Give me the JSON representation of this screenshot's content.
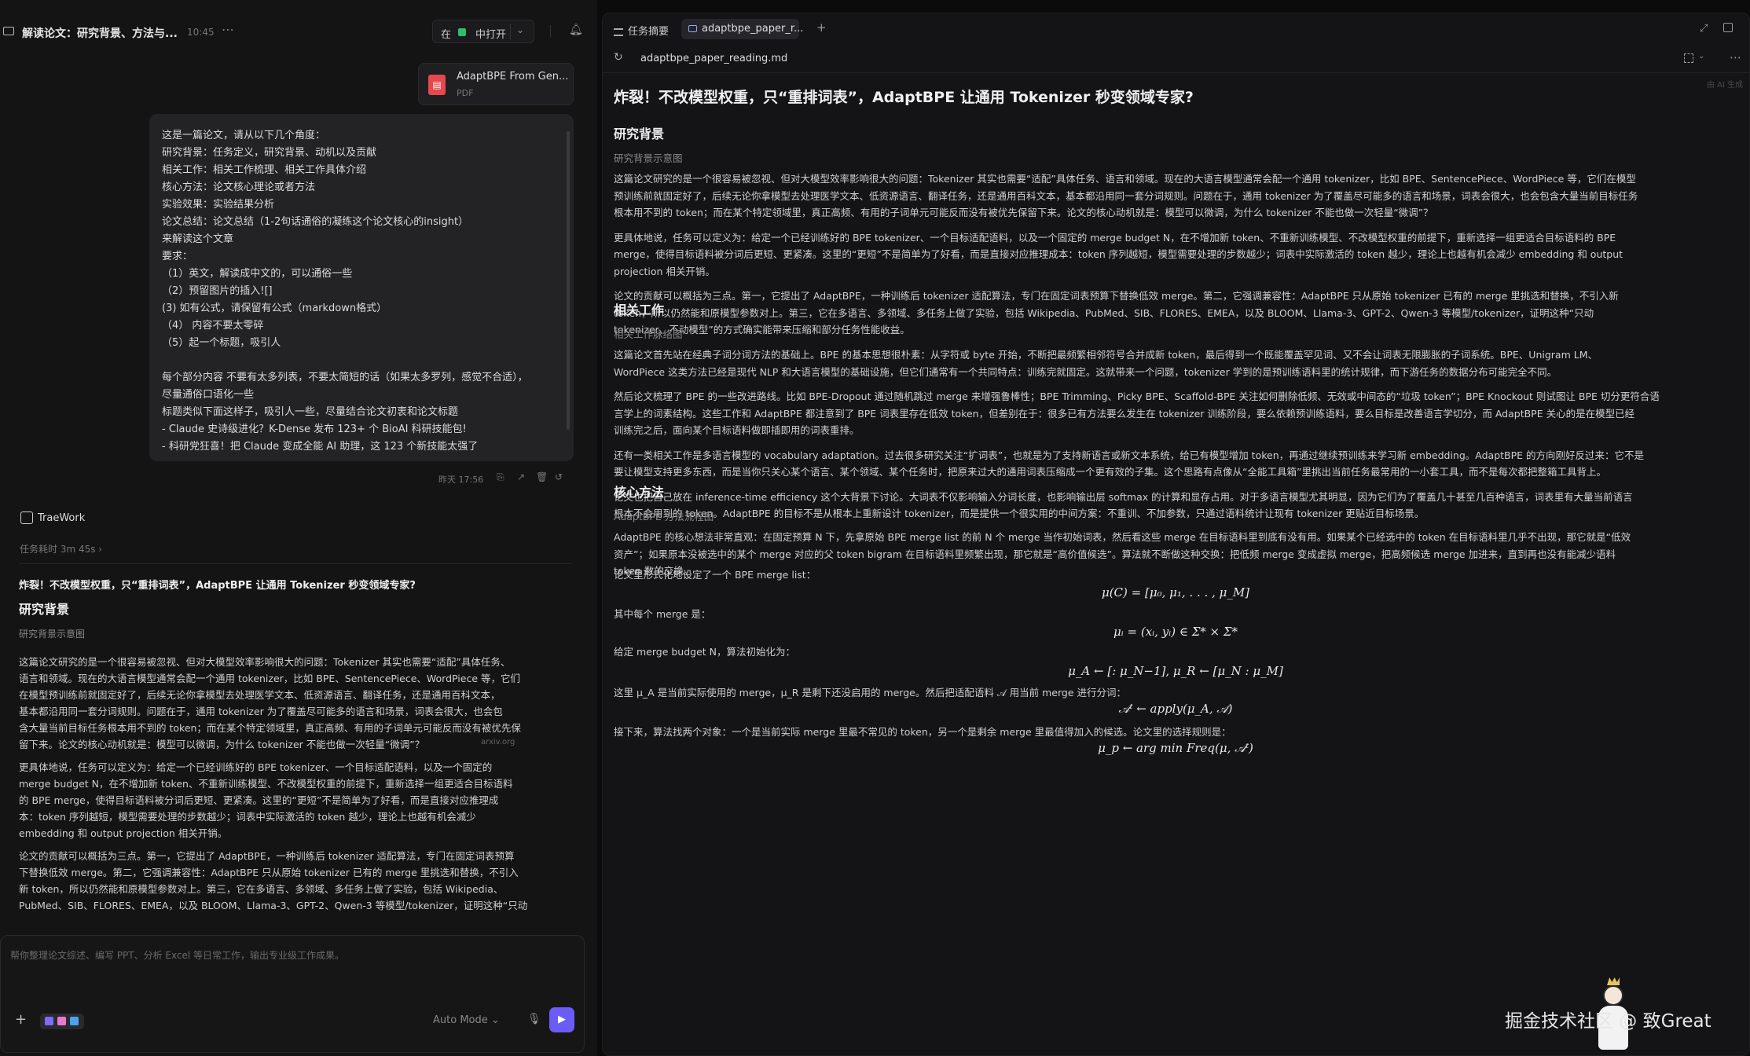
{
  "left": {
    "title": "解读论文：研究背景、方法与...",
    "time": "10:45",
    "open_in": {
      "prefix": "在",
      "app": "中打开"
    },
    "pdf": {
      "name": "AdaptBPE From Gen...",
      "type": "PDF"
    },
    "user_lines": [
      "这是一篇论文，请从以下几个角度：",
      "研究背景：任务定义，研究背景、动机以及贡献",
      "相关工作：相关工作梳理、相关工作具体介绍",
      "核心方法：论文核心理论或者方法",
      "实验效果：实验结果分析",
      "论文总结：论文总结（1-2句话通俗的凝练这个论文核心的insight）",
      "来解读这个文章",
      "要求：",
      "（1）英文，解读成中文的，可以通俗一些",
      "（2）预留图片的插入![]",
      "(3) 如有公式，请保留有公式（markdown格式）",
      "（4） 内容不要太零碎",
      "（5）起一个标题，吸引人",
      "",
      "每个部分内容 不要有太多列表，不要太简短的话（如果太多罗列，感觉不合适），",
      "尽量通俗口语化一些",
      "标题类似下面这样子，吸引人一些，尽量结合论文初衷和论文标题",
      "- Claude 史诗级进化？K-Dense 发布 123+ 个 BioAI 科研技能包!",
      "- 科研党狂喜！把 Claude 变成全能 AI 助理，这 123 个新技能太强了"
    ],
    "msg_time": "昨天 17:56",
    "agent_name": "TraeWork",
    "task_time": "任务耗时 3m 45s ›",
    "answer": {
      "title": "炸裂！不改模型权重，只“重排词表”，AdaptBPE 让通用 Tokenizer 秒变领域专家?",
      "h2": "研究背景",
      "caption": "研究背景示意图",
      "lines": [
        "这篇论文研究的是一个很容易被忽视、但对大模型效率影响很大的问题：Tokenizer 其实也需要“适配”具体任务、",
        "语言和领域。现在的大语言模型通常会配一个通用 tokenizer，比如 BPE、SentencePiece、WordPiece 等，它们",
        "在模型预训练前就固定好了，后续无论你拿模型去处理医学文本、低资源语言、翻译任务，还是通用百科文本，",
        "基本都沿用同一套分词规则。问题在于，通用 tokenizer 为了覆盖尽可能多的语言和场景，词表会很大，也会包",
        "含大量当前目标任务根本用不到的 token；而在某个特定领域里，真正高频、有用的子词单元可能反而没有被优先保",
        "留下来。论文的核心动机就是：模型可以微调，为什么 tokenizer 不能也做一次轻量“微调”？",
        "",
        "更具体地说，任务可以定义为：给定一个已经训练好的 BPE tokenizer、一个目标适配语料，以及一个固定的",
        "merge budget N，在不增加新 token、不重新训练模型、不改模型权重的前提下，重新选择一组更适合目标语料",
        "的 BPE merge，使得目标语料被分词后更短、更紧凑。这里的“更短”不是简单为了好看，而是直接对应推理成",
        "本：token 序列越短，模型需要处理的步数越少；词表中实际激活的 token 越少，理论上也越有机会减少",
        "embedding 和 output projection 相关开销。",
        "",
        "论文的贡献可以概括为三点。第一，它提出了 AdaptBPE，一种训练后 tokenizer 适配算法，专门在固定词表预算",
        "下替换低效 merge。第二，它强调兼容性：AdaptBPE 只从原始 tokenizer 已有的 merge 里挑选和替换，不引入",
        "新 token，所以仍然能和原模型参数对上。第三，它在多语言、多领域、多任务上做了实验，包括 Wikipedia、",
        "PubMed、SIB、FLORES、EMEA，以及 BLOOM、Llama-3、GPT-2、Qwen-3 等模型/tokenizer，证明这种“只动"
      ],
      "source": "arxiv.org"
    },
    "composer": {
      "placeholder": "帮你整理论文综述、编写 PPT、分析 Excel 等日常工作，输出专业级工作成果。",
      "mode": "Auto Mode ⌄"
    }
  },
  "right": {
    "tabs": {
      "summary": "任务摘要",
      "file": "adaptbpe_paper_r..."
    },
    "path": "adaptbpe_paper_reading.md",
    "hint": "由 AI 生成",
    "doc": {
      "title": "炸裂！不改模型权重，只“重排词表”，AdaptBPE 让通用 Tokenizer 秒变领域专家?",
      "s1_h": "研究背景",
      "s1_cap": "研究背景示意图",
      "s1_lines": [
        "这篇论文研究的是一个很容易被忽视、但对大模型效率影响很大的问题：Tokenizer 其实也需要“适配”具体任务、语言和领域。现在的大语言模型通常会配一个通用 tokenizer，比如 BPE、SentencePiece、WordPiece 等，它们在模型",
        "预训练前就固定好了，后续无论你拿模型去处理医学文本、低资源语言、翻译任务，还是通用百科文本，基本都沿用同一套分词规则。问题在于，通用 tokenizer 为了覆盖尽可能多的语言和场景，词表会很大，也会包含大量当前目标任务",
        "根本用不到的 token；而在某个特定领域里，真正高频、有用的子词单元可能反而没有被优先保留下来。论文的核心动机就是：模型可以微调，为什么 tokenizer 不能也做一次轻量“微调”？",
        "更具体地说，任务可以定义为：给定一个已经训练好的 BPE tokenizer、一个目标适配语料，以及一个固定的 merge budget N，在不增加新 token、不重新训练模型、不改模型权重的前提下，重新选择一组更适合目标语料的 BPE",
        "merge，使得目标语料被分词后更短、更紧凑。这里的“更短”不是简单为了好看，而是直接对应推理成本：token 序列越短，模型需要处理的步数越少；词表中实际激活的 token 越少，理论上也越有机会减少 embedding 和 output",
        "projection 相关开销。",
        "论文的贡献可以概括为三点。第一，它提出了 AdaptBPE，一种训练后 tokenizer 适配算法，专门在固定词表预算下替换低效 merge。第二，它强调兼容性：AdaptBPE 只从原始 tokenizer 已有的 merge 里挑选和替换，不引入新",
        "token，所以仍然能和原模型参数对上。第三，它在多语言、多领域、多任务上做了实验，包括 Wikipedia、PubMed、SIB、FLORES、EMEA，以及 BLOOM、Llama-3、GPT-2、Qwen-3 等模型/tokenizer，证明这种“只动",
        "tokenizer、不动模型”的方式确实能带来压缩和部分任务性能收益。"
      ],
      "s2_h": "相关工作",
      "s2_cap": "相关工作脉络图",
      "s2_lines": [
        "这篇论文首先站在经典子词分词方法的基础上。BPE 的基本思想很朴素：从字符或 byte 开始，不断把最频繁相邻符号合并成新 token，最后得到一个既能覆盖罕见词、又不会让词表无限膨胀的子词系统。BPE、Unigram LM、",
        "WordPiece 这类方法已经是现代 NLP 和大语言模型的基础设施，但它们通常有一个共同特点：训练完就固定。这就带来一个问题，tokenizer 学到的是预训练语料里的统计规律，而下游任务的数据分布可能完全不同。",
        "然后论文梳理了 BPE 的一些改进路线。比如 BPE-Dropout 通过随机跳过 merge 来增强鲁棒性；BPE Trimming、Picky BPE、Scaffold-BPE 关注如何删除低频、无效或中间态的“垃圾 token”；BPE Knockout 则试图让 BPE 切分更符合语",
        "言学上的词素结构。这些工作和 AdaptBPE 都注意到了 BPE 词表里存在低效 token，但差别在于：很多已有方法要么发生在 tokenizer 训练阶段，要么依赖预训练语料，要么目标是改善语言学切分，而 AdaptBPE 关心的是在模型已经",
        "训练完之后，面向某个目标语料做即插即用的词表重排。",
        "还有一类相关工作是多语言模型的 vocabulary adaptation。过去很多研究关注“扩词表”，也就是为了支持新语言或新文本系统，给已有模型增加 token，再通过继续预训练来学习新 embedding。AdaptBPE 的方向刚好反过来：它不是",
        "要让模型支持更多东西，而是当你只关心某个语言、某个领域、某个任务时，把原来过大的通用词表压缩成一个更有效的子集。这个思路有点像从“全能工具箱”里挑出当前任务最常用的一小套工具，而不是每次都把整箱工具背上。",
        "论文也把自己放在 inference-time efficiency 这个大背景下讨论。大词表不仅影响输入分词长度，也影响输出层 softmax 的计算和显存占用。对于多语言模型尤其明显，因为它们为了覆盖几十甚至几百种语言，词表里有大量当前语言",
        "根本不会用到的 token。AdaptBPE 的目标不是从根本上重新设计 tokenizer，而是提供一个很实用的中间方案：不重训、不加参数，只通过语料统计让现有 tokenizer 更贴近目标场景。"
      ],
      "s3_h": "核心方法",
      "s3_cap": "AdaptBPE 方法流程图",
      "s3_lines": [
        "AdaptBPE 的核心想法非常直观：在固定预算 N 下，先拿原始 BPE merge list 的前 N 个 merge 当作初始词表，然后看这些 merge 在目标语料里到底有没有用。如果某个已经选中的 token 在目标语料里几乎不出现，那它就是“低效",
        "资产”；如果原本没被选中的某个 merge 对应的父 token bigram 在目标语料里频繁出现，那它就是“高价值候选”。算法就不断做这种交换：把低频 merge 变成虚拟 merge，把高频候选 merge 加进来，直到再也没有能减少语料",
        "token 数的交换。"
      ],
      "s3_p2": "论文里形式化地设定了一个 BPE merge list：",
      "f1": "μ(C) = [μ₀, μ₁, . . . , μ_M]",
      "s3_p3": "其中每个 merge 是：",
      "f2": "μᵢ = (xᵢ, yᵢ) ∈ Σ* × Σ*",
      "s3_p4": "给定 merge budget N，算法初始化为：",
      "f3": "μ_A ← [: μ_N−1],    μ_R ← [μ_N : μ_M]",
      "s3_p5": "这里 μ_A 是当前实际使用的 merge，μ_R 是剩下还没启用的 merge。然后把适配语料 𝒜 用当前 merge 进行分词：",
      "f4": "𝒜ᵗ ← apply(μ_A, 𝒜)",
      "s3_p6": "接下来，算法找两个对象：一个是当前实际 merge 里最不常见的 token，另一个是剩余 merge 里最值得加入的候选。论文里的选择规则是：",
      "f5": "μ_p ← arg min Freq(μ, 𝒜ᵗ)"
    }
  },
  "watermark": "掘金技术社区 @ 致Great"
}
